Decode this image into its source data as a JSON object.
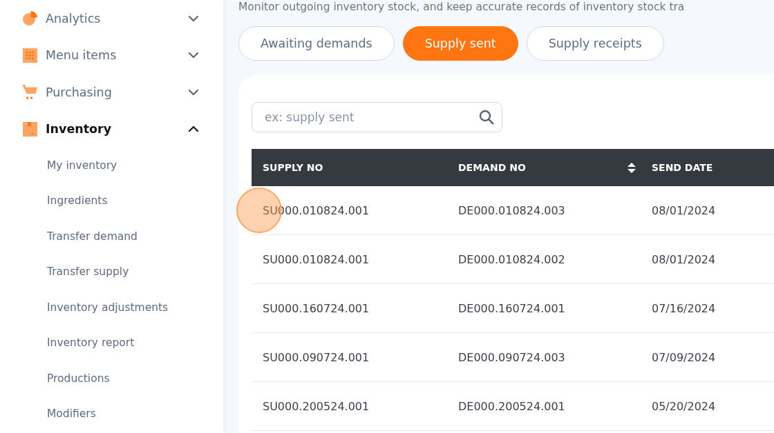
{
  "sidebar": {
    "items": [
      {
        "label": "Analytics",
        "selected": false,
        "expanded": false
      },
      {
        "label": "Menu items",
        "selected": false,
        "expanded": false
      },
      {
        "label": "Purchasing",
        "selected": false,
        "expanded": false
      },
      {
        "label": "Inventory",
        "selected": true,
        "expanded": true,
        "children": [
          {
            "label": "My inventory",
            "selected": false
          },
          {
            "label": "Ingredients",
            "selected": false
          },
          {
            "label": "Transfer demand",
            "selected": false
          },
          {
            "label": "Transfer supply",
            "selected": false
          },
          {
            "label": "Inventory adjustments",
            "selected": false
          },
          {
            "label": "Inventory report",
            "selected": false
          },
          {
            "label": "Productions",
            "selected": false
          },
          {
            "label": "Modifiers",
            "selected": false
          }
        ]
      }
    ]
  },
  "description": "Monitor outgoing inventory stock, and keep accurate records of inventory stock tra",
  "tabs": [
    {
      "label": "Awaiting demands",
      "selected": false
    },
    {
      "label": "Supply sent",
      "selected": true
    },
    {
      "label": "Supply receipts",
      "selected": false
    }
  ],
  "search": {
    "placeholder": "ex: supply sent"
  },
  "table": {
    "columns": [
      {
        "label": "SUPPLY NO",
        "sortable": false
      },
      {
        "label": "DEMAND NO",
        "sortable": true
      },
      {
        "label": "SEND DATE",
        "sortable": false
      }
    ],
    "rows": [
      {
        "cells": [
          "SU000.010824.001",
          "DE000.010824.003",
          "08/01/2024"
        ],
        "clicked": true
      },
      {
        "cells": [
          "SU000.010824.001",
          "DE000.010824.002",
          "08/01/2024"
        ],
        "clicked": false
      },
      {
        "cells": [
          "SU000.160724.001",
          "DE000.160724.001",
          "07/16/2024"
        ],
        "clicked": false
      },
      {
        "cells": [
          "SU000.090724.001",
          "DE000.090724.003",
          "07/09/2024"
        ],
        "clicked": false
      },
      {
        "cells": [
          "SU000.200524.001",
          "DE000.200524.001",
          "05/20/2024"
        ],
        "clicked": false
      }
    ]
  }
}
